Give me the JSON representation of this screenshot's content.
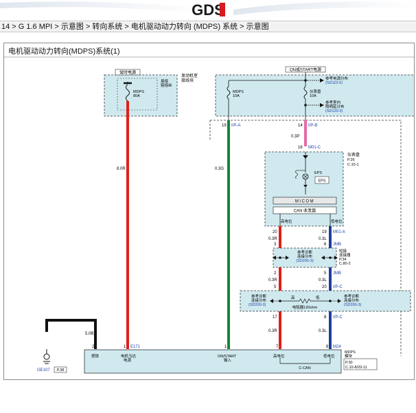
{
  "header": {
    "logo_text": "GDS",
    "accent_color": "#d71920",
    "logo_color": "#1a1a1a"
  },
  "breadcrumb": {
    "text": "14 > G 1.6 MPI > 示意图 > 转向系统 > 电机驱动动力转向 (MDPS) 系统 > 示意图"
  },
  "diagram": {
    "title": "电机驱动动力转向(MDPS)系统(1)",
    "labels": {
      "hot_at_all_times": "常时电源",
      "engine_room_box_1": "发动机室",
      "engine_room_box_2": "接线块",
      "fusible_link_1": "易熔",
      "fusible_link_2": "链熔丝",
      "mdps_fuse": "MDPS",
      "mdps_fuse_amp": "80A",
      "on_start_power": "ON或START电源",
      "ref_power_dist": "参考电源分布",
      "ref_power_dist_code": "(SD110-5)",
      "mdps_10a": "MDPS",
      "mdps_10a_amp": "10A",
      "cluster_fuse": "仪表盘",
      "cluster_fuse_amp": "10A",
      "ref_interior": "参考室内",
      "ref_interior_2": "照明延分布",
      "ref_interior_code": "(SD120-2)",
      "pin19": "19",
      "ip_a": "I/P-A",
      "pin14": "14",
      "ip_b": "I/P-B",
      "wire_03p": "0.3P",
      "pin16": "16",
      "m01_c": "M01-C",
      "wire_80r": "8.0R",
      "wire_03g": "0.3G",
      "cluster": "仪表盘",
      "cluster_page": "P.26",
      "cluster_conn": "C.10-1",
      "eps_lamp": "EPS",
      "eps_box": "EPS",
      "micom": "MICOM",
      "can_transceiver": "CAN 收发器",
      "can_high": "高电位",
      "can_low": "低电位",
      "pin20a": "20",
      "pin19b": "19",
      "m01_a": "M01-A",
      "wire_03r_1": "0.3R",
      "wire_03l_1": "0.3L",
      "pin3": "3",
      "pin6": "6",
      "jmb_1": "JMB",
      "ref_diag_1": "参考诊断",
      "ref_diag_2": "连接分布",
      "ref_diag_code": "(SD200-3)",
      "jc_1": "短接",
      "jc_2": "连接器",
      "jc_page": "P.34",
      "jc_conn": "C.80-2",
      "pin2": "2",
      "pin5": "5",
      "jmb_2": "JMB",
      "wire_03r_2": "0.3R",
      "wire_03l_2": "0.3L",
      "pin5b": "5",
      "pin20b": "20",
      "ip_c": "I/P-C",
      "ref_diag_left_1": "参考诊断",
      "ref_diag_left_2": "连接分布",
      "ref_diag_left_code": "(SD200-3)",
      "hi": "高",
      "lo": "低",
      "resistor": "电阻器120ohm",
      "ref_diag_right_1": "参考诊断",
      "ref_diag_right_2": "连接分布",
      "ref_diag_right_code": "(SD200-3)",
      "pin17": "17",
      "pin8": "8",
      "ip_c2": "I/P-C",
      "wire_03r_3": "0.3R",
      "wire_03l_3": "0.3L",
      "wire_50b": "5.0B",
      "pin2g": "2",
      "pin1": "1",
      "e171": "E171",
      "pin1b": "1",
      "pin7": "7",
      "pin8b": "8",
      "m24": "M24",
      "ground_label": "搭铁",
      "motor_power_1": "电机马达",
      "motor_power_2": "电源",
      "on_start_in_1": "ON/START",
      "on_start_in_2": "输入",
      "can_high_b": "高电位",
      "can_low_b": "低电位",
      "c_can": "C-CAN",
      "mdps_module_1": "MDPS",
      "mdps_module_2": "模块",
      "mdps_page": "P.30",
      "mdps_conn": "C.10-8/20-11",
      "ge107": "GE107",
      "ge107_page": "P.38"
    },
    "colors": {
      "red_wire": "#e0201a",
      "green_wire": "#12853a",
      "blue_wire": "#1b3f9c",
      "pink_wire": "#e46aa8",
      "black_wire": "#111111",
      "box_fill": "#cfe9ef",
      "link_text": "#1c3fa6"
    }
  }
}
